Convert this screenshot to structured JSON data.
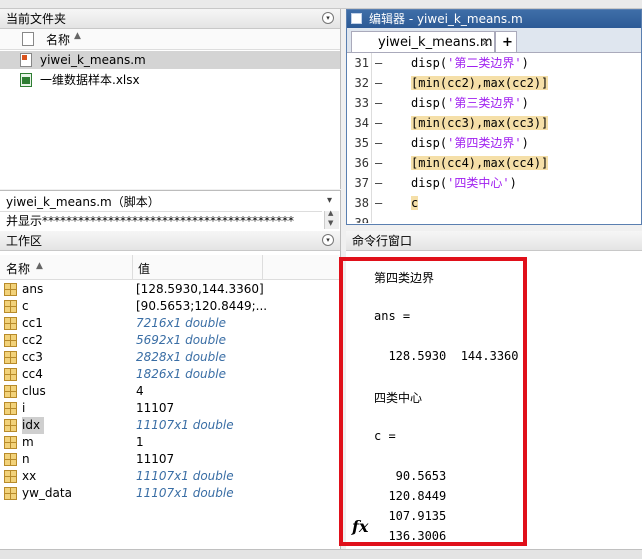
{
  "current_folder": {
    "title": "当前文件夹",
    "column_name": "名称",
    "files": [
      {
        "name": "yiwei_k_means.m",
        "icon": "m-file-icon"
      },
      {
        "name": "一维数据样本.xlsx",
        "icon": "excel-file-icon"
      }
    ]
  },
  "details": {
    "title": "yiwei_k_means.m（脚本）",
    "preview": "并显示******************************************"
  },
  "workspace": {
    "title": "工作区",
    "col_name": "名称",
    "col_value": "值",
    "vars": [
      {
        "name": "ans",
        "value": "[128.5930,144.3360]",
        "dim": false
      },
      {
        "name": "c",
        "value": "[90.5653;120.8449;...",
        "dim": false
      },
      {
        "name": "cc1",
        "value": "7216x1 double",
        "dim": true
      },
      {
        "name": "cc2",
        "value": "5692x1 double",
        "dim": true
      },
      {
        "name": "cc3",
        "value": "2828x1 double",
        "dim": true
      },
      {
        "name": "cc4",
        "value": "1826x1 double",
        "dim": true
      },
      {
        "name": "clus",
        "value": "4",
        "dim": false
      },
      {
        "name": "i",
        "value": "11107",
        "dim": false
      },
      {
        "name": "idx",
        "value": "11107x1 double",
        "dim": true,
        "selected": true
      },
      {
        "name": "m",
        "value": "1",
        "dim": false
      },
      {
        "name": "n",
        "value": "11107",
        "dim": false
      },
      {
        "name": "xx",
        "value": "11107x1 double",
        "dim": true
      },
      {
        "name": "yw_data",
        "value": "11107x1 double",
        "dim": true
      }
    ]
  },
  "editor": {
    "title": "编辑器 - yiwei_k_means.m",
    "tab_label": "yiwei_k_means.m",
    "add_tab": "+",
    "lines": [
      {
        "num": "31",
        "dash": "—",
        "pre": "disp(",
        "str": "'第二类边界'",
        "post": ")",
        "hl": false
      },
      {
        "num": "32",
        "dash": "—",
        "pre": "[min(cc2),max(cc2)]",
        "str": "",
        "post": "",
        "hl": true
      },
      {
        "num": "33",
        "dash": "—",
        "pre": "disp(",
        "str": "'第三类边界'",
        "post": ")",
        "hl": false
      },
      {
        "num": "34",
        "dash": "—",
        "pre": "[min(cc3),max(cc3)]",
        "str": "",
        "post": "",
        "hl": true
      },
      {
        "num": "35",
        "dash": "—",
        "pre": "disp(",
        "str": "'第四类边界'",
        "post": ")",
        "hl": false
      },
      {
        "num": "36",
        "dash": "—",
        "pre": "[min(cc4),max(cc4)]",
        "str": "",
        "post": "",
        "hl": true
      },
      {
        "num": "37",
        "dash": "—",
        "pre": "disp(",
        "str": "'四类中心'",
        "post": ")",
        "hl": false
      },
      {
        "num": "38",
        "dash": "—",
        "pre": "c",
        "str": "",
        "post": "",
        "hl": true
      },
      {
        "num": "39",
        "dash": "",
        "pre": "",
        "str": "",
        "post": "",
        "hl": false
      }
    ]
  },
  "command_window": {
    "title": "命令行窗口",
    "fx": "fx",
    "lines": [
      "第四类边界",
      "",
      "ans =",
      "",
      "  128.5930  144.3360",
      "",
      "四类中心",
      "",
      "c =",
      "",
      "   90.5653",
      "  120.8449",
      "  107.9135",
      "  136.3006"
    ]
  },
  "colors": {
    "highlight_box": "#e0101a",
    "editor_title": "#2d5a96",
    "string": "#a020f0"
  }
}
